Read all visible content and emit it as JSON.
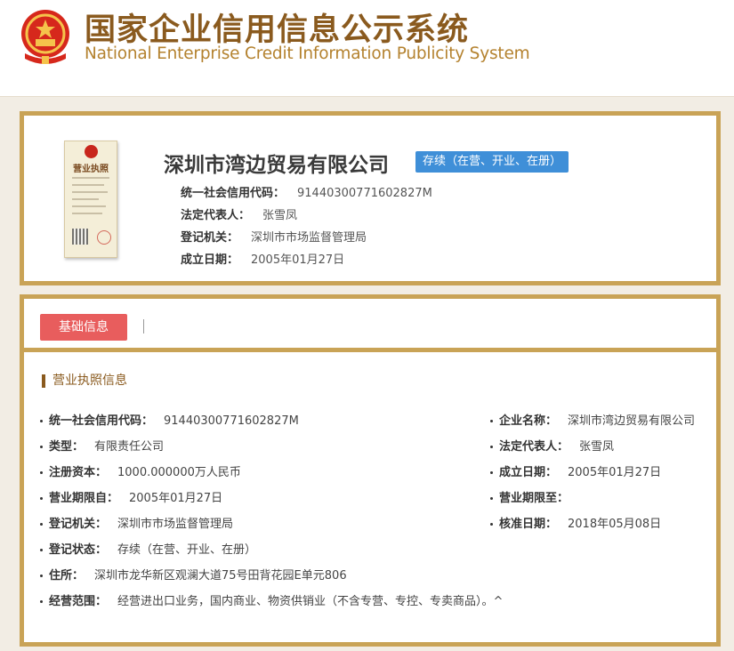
{
  "header": {
    "title_cn": "国家企业信用信息公示系统",
    "title_en": "National Enterprise Credit Information Publicity System"
  },
  "license_card": {
    "title": "营业执照"
  },
  "company": {
    "name": "深圳市湾边贸易有限公司",
    "status": "存续（在营、开业、在册）",
    "summary": [
      {
        "label": "统一社会信用代码：",
        "value": "91440300771602827M"
      },
      {
        "label": "法定代表人：",
        "value": "张雪凤"
      },
      {
        "label": "登记机关：",
        "value": "深圳市市场监督管理局"
      },
      {
        "label": "成立日期：",
        "value": "2005年01月27日"
      }
    ]
  },
  "tabs": {
    "basic": "基础信息"
  },
  "section": {
    "title": "营业执照信息"
  },
  "details": {
    "left": [
      {
        "label": "统一社会信用代码：",
        "value": "91440300771602827M"
      },
      {
        "label": "类型：",
        "value": "有限责任公司"
      },
      {
        "label": "注册资本：",
        "value": "1000.000000万人民币"
      },
      {
        "label": "营业期限自：",
        "value": "2005年01月27日"
      },
      {
        "label": "登记机关：",
        "value": "深圳市市场监督管理局"
      },
      {
        "label": "登记状态：",
        "value": "存续（在营、开业、在册）"
      },
      {
        "label": "住所：",
        "value": "深圳市龙华新区观澜大道75号田背花园E单元806"
      },
      {
        "label": "经营范围：",
        "value": "经营进出口业务，国内商业、物资供销业（不含专营、专控、专卖商品）。^"
      }
    ],
    "right": [
      {
        "label": "企业名称：",
        "value": "深圳市湾边贸易有限公司"
      },
      {
        "label": "法定代表人：",
        "value": "张雪凤"
      },
      {
        "label": "成立日期：",
        "value": "2005年01月27日"
      },
      {
        "label": "营业期限至：",
        "value": ""
      },
      {
        "label": "核准日期：",
        "value": "2018年05月08日"
      }
    ]
  },
  "colors": {
    "brand_gold": "#c9a356",
    "title_brown": "#8a5a1e",
    "status_blue": "#3f8fd8",
    "tab_red": "#e85d5d"
  }
}
